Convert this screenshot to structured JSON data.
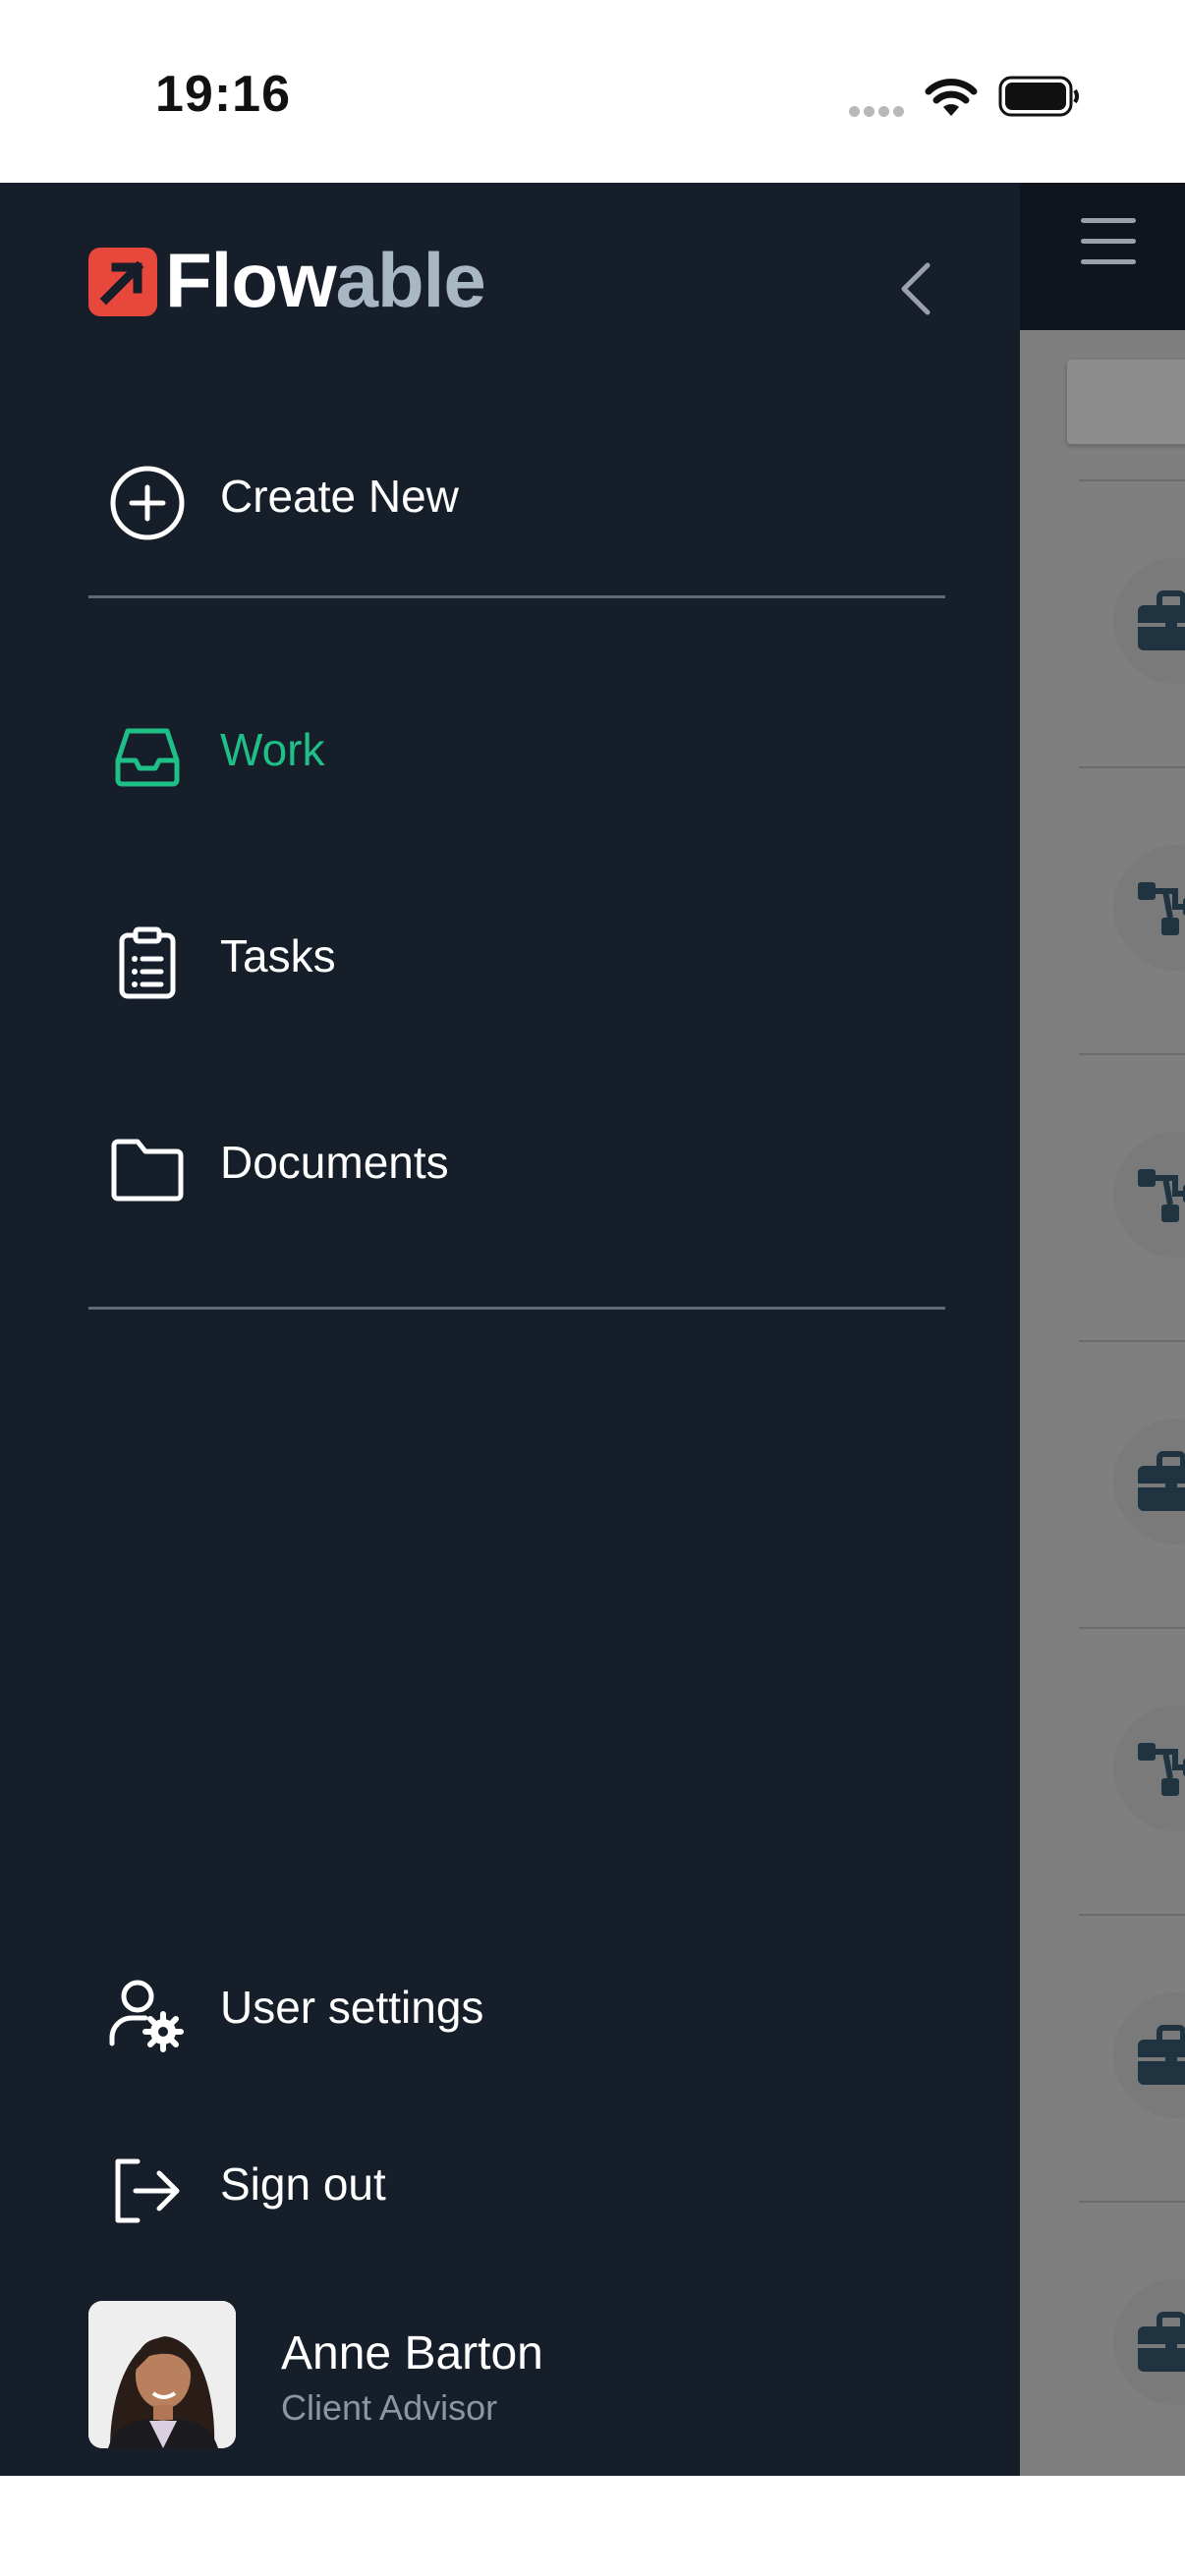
{
  "status_bar": {
    "time": "19:16"
  },
  "logo": {
    "flow": "Flow",
    "able": "able"
  },
  "menu": {
    "create_new": "Create New",
    "work": "Work",
    "tasks": "Tasks",
    "documents": "Documents",
    "user_settings": "User settings",
    "sign_out": "Sign out"
  },
  "user": {
    "name": "Anne Barton",
    "role": "Client Advisor"
  },
  "colors": {
    "drawer_bg": "#161e2a",
    "active": "#1fbf88",
    "brand_red": "#e8473c"
  },
  "background_list_icons": [
    "briefcase-icon",
    "process-icon",
    "process-icon",
    "briefcase-icon",
    "process-icon",
    "briefcase-icon",
    "briefcase-icon"
  ]
}
